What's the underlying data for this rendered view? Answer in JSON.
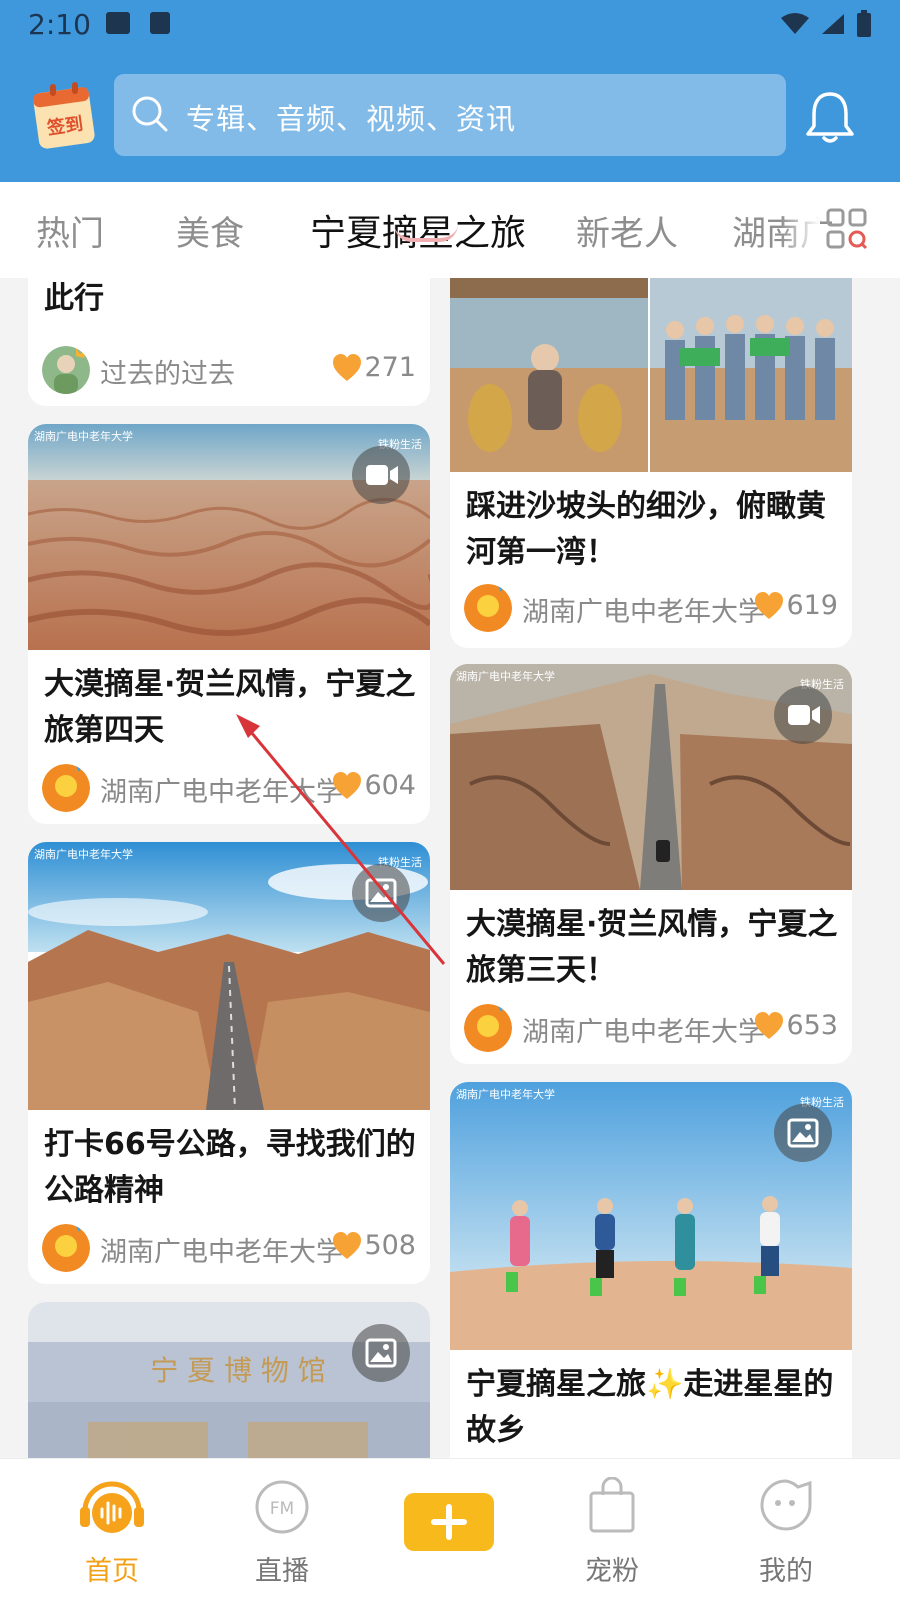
{
  "status_bar": {
    "time": "2:10"
  },
  "search": {
    "placeholder": "专辑、音频、视频、资讯"
  },
  "checkin": {
    "label": "签到"
  },
  "tabs": [
    {
      "label": "热门"
    },
    {
      "label": "美食"
    },
    {
      "label": "宁夏摘星之旅",
      "active": true
    },
    {
      "label": "新老人"
    },
    {
      "label": "湖南广"
    }
  ],
  "feed": {
    "left": [
      {
        "title": "宁夏旅行，凌南门·谋，不虚此行",
        "title_visible": "此行",
        "author": "过去的过去",
        "likes": "271"
      },
      {
        "title": "大漠摘星·贺兰风情，宁夏之旅第四天",
        "author": "湖南广电中老年大学",
        "likes": "604",
        "media": "video",
        "brand": "湖南广电中老年大学",
        "brand_right": "铁粉生活"
      },
      {
        "title": "打卡66号公路，寻找我们的公路精神",
        "author": "湖南广电中老年大学",
        "likes": "508",
        "media": "image",
        "brand": "湖南广电中老年大学",
        "brand_right": "铁粉生活"
      },
      {
        "title": "",
        "author": "",
        "likes": "",
        "media": "image",
        "sign_text": "宁 夏 博 物 馆"
      }
    ],
    "right": [
      {
        "title": "踩进沙坡头的细沙，俯瞰黄河第一湾！",
        "author": "湖南广电中老年大学",
        "likes": "619"
      },
      {
        "title": "大漠摘星·贺兰风情，宁夏之旅第三天！",
        "author": "湖南广电中老年大学",
        "likes": "653",
        "media": "video",
        "brand": "湖南广电中老年大学",
        "brand_right": "铁粉生活"
      },
      {
        "title": "宁夏摘星之旅✨走进星星的故乡",
        "author": "",
        "likes": "",
        "media": "image",
        "brand": "湖南广电中老年大学",
        "brand_right": "铁粉生活"
      }
    ]
  },
  "bottom_nav": [
    {
      "label": "首页",
      "active": true
    },
    {
      "label": "直播"
    },
    {
      "label": ""
    },
    {
      "label": "宠粉"
    },
    {
      "label": "我的"
    }
  ],
  "colors": {
    "header": "#3f97dc",
    "accent": "#f2a116",
    "heart": "#f7a234",
    "plus": "#f8b91d"
  }
}
